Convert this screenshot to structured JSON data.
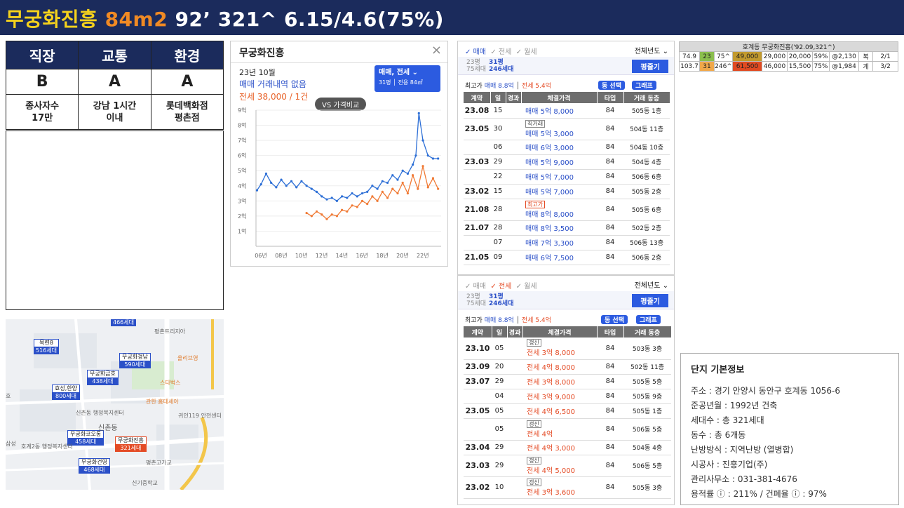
{
  "header": {
    "name": "무궁화진흥",
    "size": "84m2",
    "rest": "92’ 321^ 6.15/4.6(75%)"
  },
  "scores": {
    "headers": [
      "직장",
      "교통",
      "환경"
    ],
    "grades": [
      "B",
      "A",
      "A"
    ],
    "details": [
      [
        "종사자수",
        "17만"
      ],
      [
        "강남 1시간",
        "이내"
      ],
      [
        "롯데백화점",
        "평촌점"
      ]
    ]
  },
  "map": {
    "pins": [
      {
        "name": "",
        "count": "466세대"
      },
      {
        "name": "목련8",
        "count": "516세대"
      },
      {
        "name": "무궁화경남",
        "count": "590세대"
      },
      {
        "name": "무궁화금호",
        "count": "438세대"
      },
      {
        "name": "효성,한양",
        "count": "800세대"
      },
      {
        "name": "무궁화코오롱",
        "count": "458세대"
      },
      {
        "name": "무궁화진흥",
        "count": "321세대"
      },
      {
        "name": "무궁화건영",
        "count": "468세대"
      }
    ],
    "labels": [
      "평촌트리지아",
      "신촌동",
      "신촌동 행정복지센터",
      "호계2동 행정복지센터",
      "귀인119 안전센터",
      "평촌고가교",
      "스타벅스",
      "관한 홈테세아",
      "신기중학교",
      "호",
      "삼성",
      "올리브영"
    ]
  },
  "chart_card": {
    "title": "무궁화진흥",
    "close": "×",
    "date": "23년 10월",
    "line1": "매매 거래내역 없음",
    "line2": "전세 38,000 / 1건",
    "select_label": "매매, 전세 ⌄",
    "select_sub": "31평 │ 전용 84㎡",
    "vs": "VS 가격비교"
  },
  "chart_data": {
    "type": "line",
    "x_ticks": [
      "06년",
      "08년",
      "10년",
      "12년",
      "14년",
      "16년",
      "18년",
      "20년",
      "22년"
    ],
    "y_ticks": [
      "1억",
      "2억",
      "3억",
      "4억",
      "5억",
      "6억",
      "7억",
      "8억",
      "9억"
    ],
    "ylim": [
      0,
      9
    ],
    "series": [
      {
        "color": "#2d6fd6",
        "x": [
          2005.6,
          2006,
          2006.5,
          2007,
          2007.5,
          2008,
          2008.5,
          2009,
          2009.5,
          2010,
          2010.5,
          2011,
          2011.5,
          2012,
          2012.5,
          2013,
          2013.5,
          2014,
          2014.5,
          2015,
          2015.5,
          2016,
          2016.5,
          2017,
          2017.5,
          2018,
          2018.5,
          2019,
          2019.5,
          2020,
          2020.5,
          2021,
          2021.3,
          2021.6,
          2022,
          2022.5,
          2023,
          2023.5
        ],
        "values": [
          3.7,
          4.1,
          4.8,
          4.2,
          3.9,
          4.4,
          4.0,
          4.3,
          3.9,
          4.3,
          4.0,
          3.8,
          3.6,
          3.3,
          3.1,
          3.2,
          3.0,
          3.3,
          3.2,
          3.5,
          3.3,
          3.5,
          3.6,
          4.0,
          3.8,
          4.3,
          4.2,
          4.7,
          4.4,
          5.0,
          4.8,
          5.4,
          6.0,
          8.8,
          7.0,
          6.0,
          5.8,
          5.8
        ]
      },
      {
        "color": "#f07a35",
        "x": [
          2010.5,
          2011,
          2011.5,
          2012,
          2012.5,
          2013,
          2013.5,
          2014,
          2014.5,
          2015,
          2015.5,
          2016,
          2016.5,
          2017,
          2017.5,
          2018,
          2018.5,
          2019,
          2019.5,
          2020,
          2020.5,
          2021,
          2021.5,
          2022,
          2022.5,
          2023,
          2023.5
        ],
        "values": [
          2.2,
          2.0,
          2.3,
          2.1,
          1.8,
          2.1,
          2.0,
          2.4,
          2.3,
          2.7,
          2.6,
          3.0,
          2.8,
          3.3,
          3.0,
          3.6,
          3.2,
          3.8,
          3.5,
          4.2,
          3.5,
          4.7,
          3.8,
          5.3,
          3.9,
          4.5,
          3.8
        ]
      }
    ]
  },
  "sale_panel": {
    "tabs": [
      "✓ 매매",
      "✓ 전세",
      "✓ 월세"
    ],
    "year": "전체년도 ⌄",
    "py_a": [
      "23평",
      "75세대"
    ],
    "py_b": [
      "31평",
      "246세대"
    ],
    "btn": "평줄기",
    "hi_label": "최고가",
    "hi_m": "매매 8.8억",
    "hi_j": "전세 5.4억",
    "pill1": "동 선택",
    "pill2": "그래프",
    "cols": [
      "계약",
      "일",
      "경과",
      "체결가격",
      "타입",
      "거래 동층"
    ],
    "rows": [
      {
        "ym": "23.08",
        "d": "15",
        "tag": "",
        "price": "매매 5억 8,000",
        "type": "84",
        "dong": "505동 1층"
      },
      {
        "ym": "23.05",
        "d": "30",
        "tag": "직거래",
        "price": "매매 5억 3,000",
        "type": "84",
        "dong": "504동 11층"
      },
      {
        "ym": "",
        "d": "06",
        "tag": "",
        "price": "매매 6억 3,000",
        "type": "84",
        "dong": "504동 10층"
      },
      {
        "ym": "23.03",
        "d": "29",
        "tag": "",
        "price": "매매 5억 9,000",
        "type": "84",
        "dong": "504동 4층"
      },
      {
        "ym": "",
        "d": "22",
        "tag": "",
        "price": "매매 5억 7,000",
        "type": "84",
        "dong": "506동 6층"
      },
      {
        "ym": "23.02",
        "d": "15",
        "tag": "",
        "price": "매매 5억 7,000",
        "type": "84",
        "dong": "505동 2층"
      },
      {
        "ym": "21.08",
        "d": "28",
        "tag": "최고가",
        "price": "매매 8억 8,000",
        "type": "84",
        "dong": "505동 6층"
      },
      {
        "ym": "21.07",
        "d": "28",
        "tag": "",
        "price": "매매 8억 3,500",
        "type": "84",
        "dong": "502동 2층"
      },
      {
        "ym": "",
        "d": "07",
        "tag": "",
        "price": "매매 7억 3,300",
        "type": "84",
        "dong": "506동 13층"
      },
      {
        "ym": "21.05",
        "d": "09",
        "tag": "",
        "price": "매매 6억 7,500",
        "type": "84",
        "dong": "506동 2층"
      }
    ]
  },
  "rent_panel": {
    "tabs": [
      "✓ 매매",
      "✓ 전세",
      "✓ 월세"
    ],
    "year": "전체년도 ⌄",
    "rows": [
      {
        "ym": "23.10",
        "d": "05",
        "tag": "갱신",
        "price": "전세 3억 8,000",
        "type": "84",
        "dong": "503동 3층"
      },
      {
        "ym": "23.09",
        "d": "20",
        "tag": "",
        "price": "전세 4억 8,000",
        "type": "84",
        "dong": "502동 11층"
      },
      {
        "ym": "23.07",
        "d": "29",
        "tag": "",
        "price": "전세 3억 8,000",
        "type": "84",
        "dong": "505동 5층"
      },
      {
        "ym": "",
        "d": "04",
        "tag": "",
        "price": "전세 3억 9,000",
        "type": "84",
        "dong": "505동 9층"
      },
      {
        "ym": "23.05",
        "d": "05",
        "tag": "",
        "price": "전세 4억 6,500",
        "type": "84",
        "dong": "505동 1층"
      },
      {
        "ym": "",
        "d": "05",
        "tag": "갱신",
        "price": "전세 4억",
        "type": "84",
        "dong": "506동 5층"
      },
      {
        "ym": "23.04",
        "d": "29",
        "tag": "",
        "price": "전세 4억 3,000",
        "type": "84",
        "dong": "504동 4층"
      },
      {
        "ym": "23.03",
        "d": "29",
        "tag": "갱신",
        "price": "전세 4억 5,000",
        "type": "84",
        "dong": "506동 5층"
      },
      {
        "ym": "23.02",
        "d": "10",
        "tag": "갱신",
        "price": "전세 3억 3,600",
        "type": "84",
        "dong": "505동 3층"
      }
    ]
  },
  "summary": {
    "title": "호계동 무궁화진흥('92.09,321^)",
    "rows": [
      [
        "74.9",
        "23",
        "75^",
        "49,000",
        "29,000",
        "20,000",
        "59%",
        "@2,130",
        "복",
        "2/1"
      ],
      [
        "103.7",
        "31",
        "246^",
        "61,500",
        "46,000",
        "15,500",
        "75%",
        "@1,984",
        "계",
        "3/2"
      ]
    ],
    "colors": [
      "#e8e8e8",
      "#8bbf4e",
      "#e8e8e8",
      "#c29a2e",
      "#e8e8e8",
      "#e8e8e8",
      "#e8e8e8",
      "#e8e8e8",
      "#e8e8e8",
      "#e8e8e8"
    ],
    "colors2": [
      "#e8e8e8",
      "#f0a84a",
      "#e8e8e8",
      "#e04a22",
      "#e8e8e8",
      "#e8e8e8",
      "#e8e8e8",
      "#e8e8e8",
      "#e8e8e8",
      "#e8e8e8"
    ]
  },
  "info": {
    "heading": "단지 기본정보",
    "lines": [
      "주소 : 경기 안양시 동안구 호계동 1056-6",
      "준공년월 : 1992년 건축",
      "세대수 : 총 321세대",
      "동수 : 총 6개동",
      "난방방식 : 지역난방 (열병합)",
      "시공사 : 진흥기업(주)",
      "관리사무소 : 031-381-4676",
      "용적률 ⓘ : 211% / 건폐율 ⓘ : 97%"
    ]
  }
}
